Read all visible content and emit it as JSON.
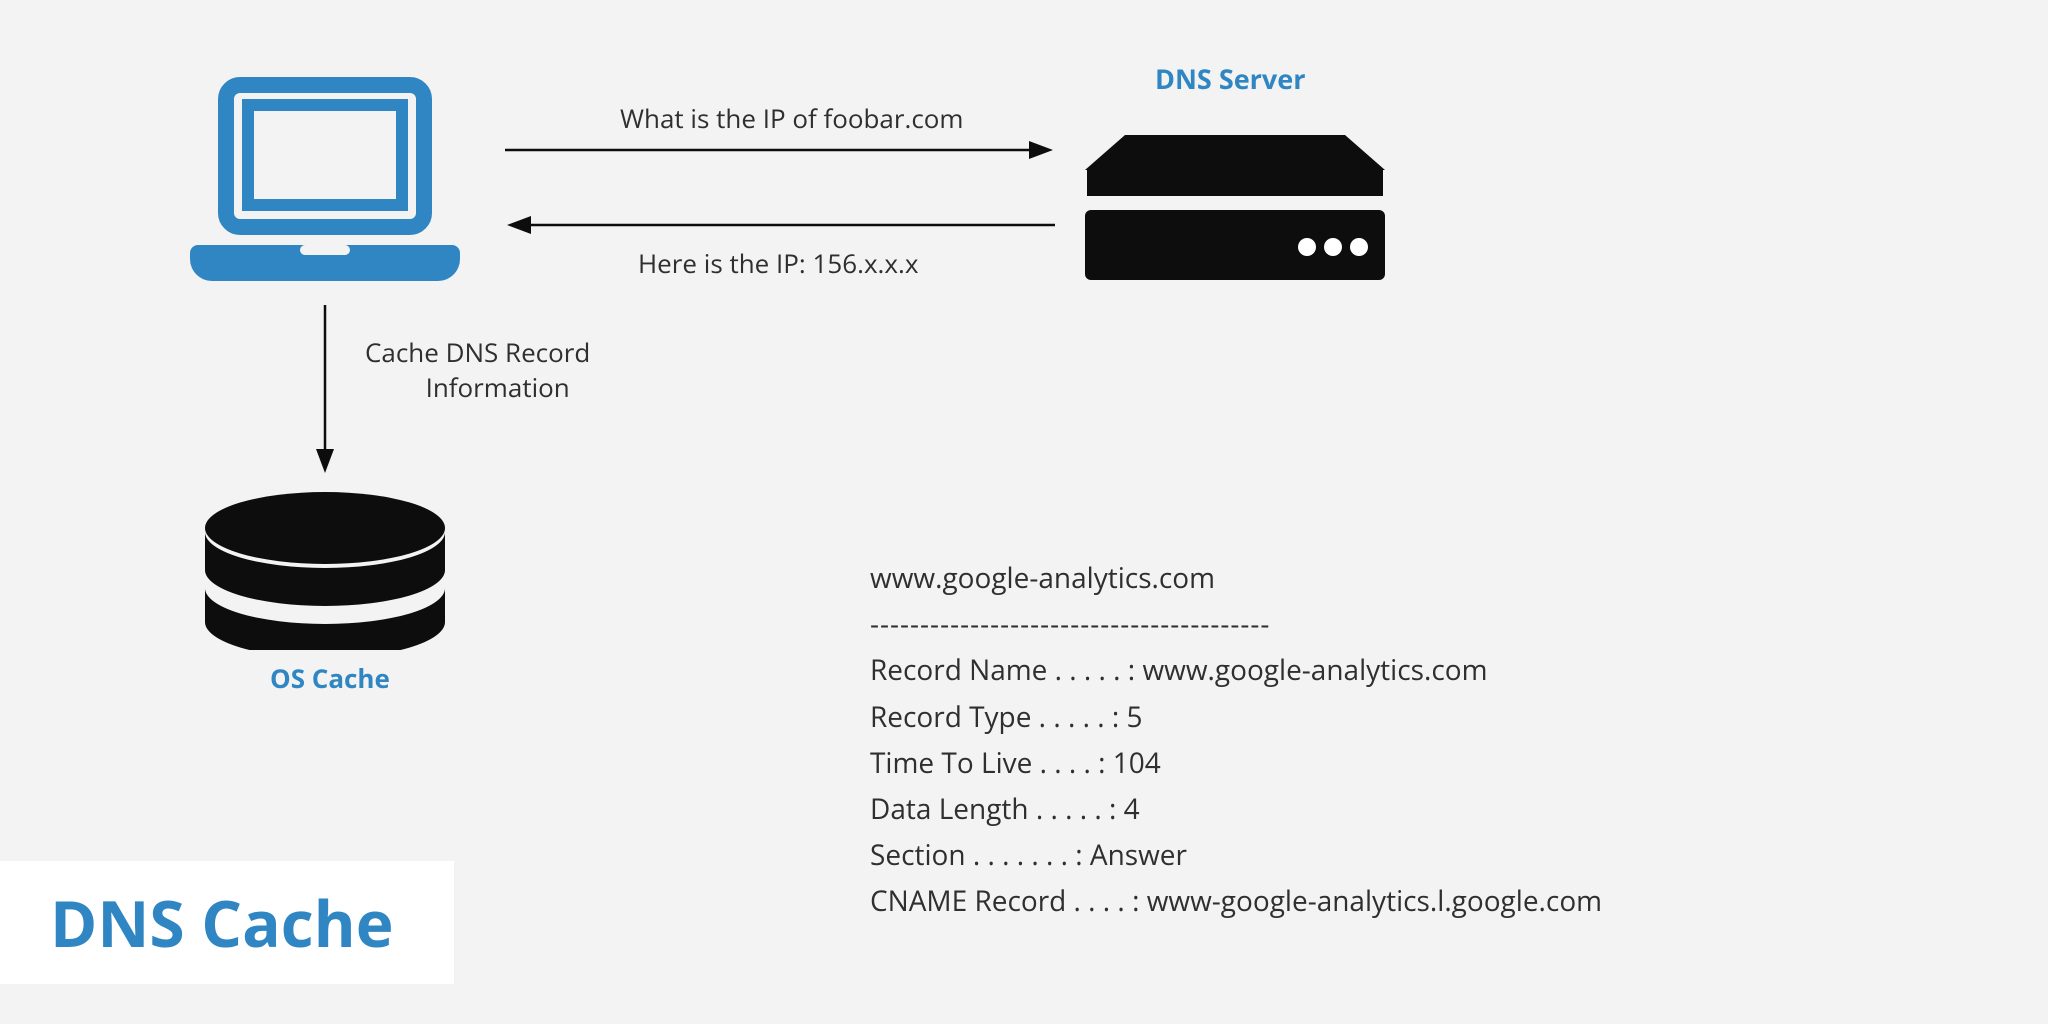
{
  "labels": {
    "dns_server": "DNS Server",
    "os_cache": "OS Cache",
    "query": "What is the IP of foobar.com",
    "response": "Here is the IP: 156.x.x.x",
    "cache_arrow_line1": "Cache DNS Record",
    "cache_arrow_line2": "Information"
  },
  "title": "DNS Cache",
  "record": {
    "host": "www.google-analytics.com",
    "separator": "----------------------------------------",
    "name_label": "Record Name . . . . . :",
    "name_value": "www.google-analytics.com",
    "type_label": "Record Type . . . . . :",
    "type_value": "5",
    "ttl_label": "Time To Live  . . . . :",
    "ttl_value": "104",
    "len_label": "Data Length . . . . . :",
    "len_value": "4",
    "section_label": "Section . . . . . . . :",
    "section_value": "Answer",
    "cname_label": "CNAME Record  . . . . :",
    "cname_value": "www-google-analytics.l.google.com"
  },
  "colors": {
    "accent": "#2f86c3",
    "ink": "#0d0d0d"
  }
}
